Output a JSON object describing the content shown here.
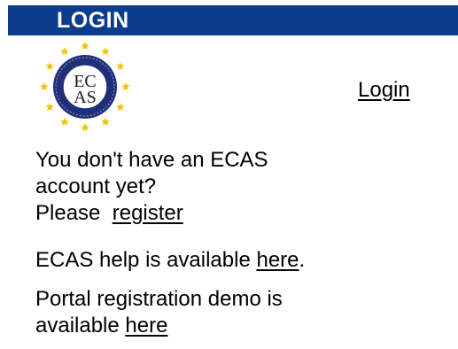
{
  "header": {
    "title": "LOGIN"
  },
  "logo": {
    "text_top": "EC",
    "text_bottom": "AS",
    "icon": "ecas-logo-icon"
  },
  "login_link": "Login",
  "register_section": {
    "line1": "You don't have an ECAS",
    "line2": "account yet?",
    "line3_prefix": "Please",
    "register_link": "register"
  },
  "help_section": {
    "prefix": "ECAS help is available ",
    "link": "here",
    "suffix": "."
  },
  "demo_section": {
    "line1": "Portal registration demo is",
    "line2_prefix": "available ",
    "link": "here"
  },
  "colors": {
    "header_bg": "#0c3c8c",
    "header_text": "#ffffff",
    "logo_ring": "#1f2f7a",
    "logo_stars": "#f2c200"
  }
}
